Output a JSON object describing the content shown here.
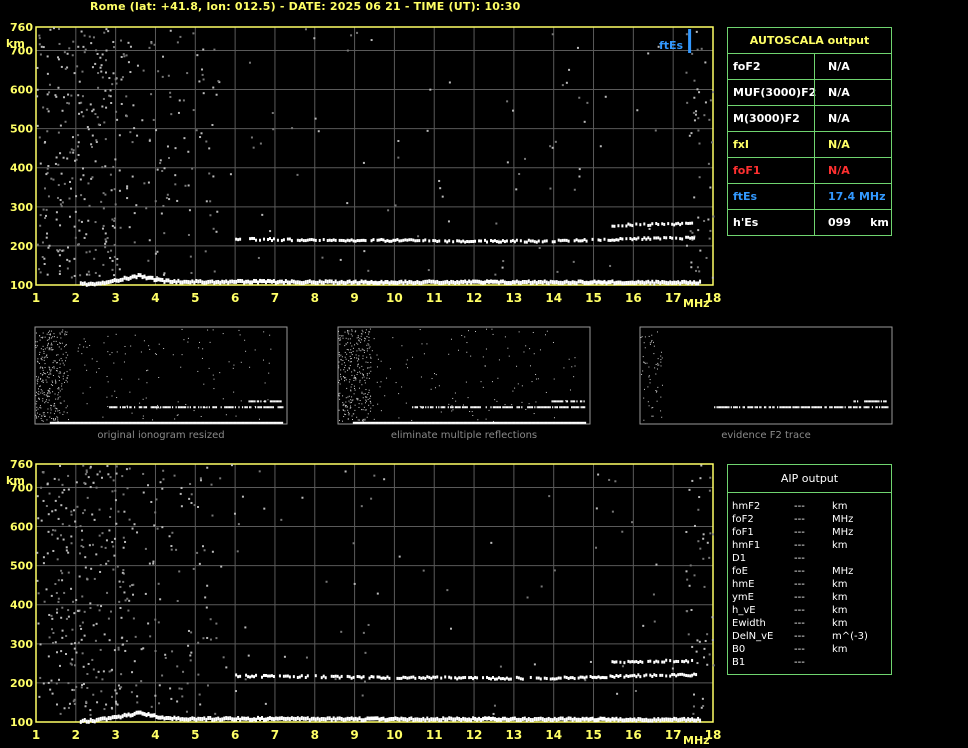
{
  "title": "Rome (lat: +41.8, lon: 012.5) - DATE: 2025 06 21 - TIME (UT): 10:30",
  "colors": {
    "frame": "#ffff66",
    "grid": "#5a5a5a",
    "table_border": "#6fd46f",
    "label_yellow": "#ffff66",
    "label_red": "#ff3030",
    "label_blue": "#3399ff",
    "caption": "#8a8a8a",
    "trace": "#ffffff"
  },
  "autoscala": {
    "title": "AUTOSCALA output",
    "rows": [
      {
        "name": "foF2",
        "value": "N/A",
        "color": "#ffffff"
      },
      {
        "name": "MUF(3000)F2",
        "value": "N/A",
        "color": "#ffffff"
      },
      {
        "name": "M(3000)F2",
        "value": "N/A",
        "color": "#ffffff"
      },
      {
        "name": "fxI",
        "value": "N/A",
        "color": "#ffff66"
      },
      {
        "name": "foF1",
        "value": "N/A",
        "color": "#ff3030"
      },
      {
        "name": "ftEs",
        "value": "17.4 MHz",
        "color": "#3399ff"
      },
      {
        "name": "h'Es",
        "value": "099     km",
        "color": "#ffffff"
      }
    ]
  },
  "aip": {
    "title": "AIP output",
    "rows": [
      {
        "name": "hmF2",
        "value": "---",
        "unit": "km"
      },
      {
        "name": "foF2",
        "value": "---",
        "unit": "MHz"
      },
      {
        "name": "foF1",
        "value": "---",
        "unit": "MHz"
      },
      {
        "name": "hmF1",
        "value": "---",
        "unit": "km"
      },
      {
        "name": "D1",
        "value": "---",
        "unit": ""
      },
      {
        "name": "foE",
        "value": "---",
        "unit": "MHz"
      },
      {
        "name": "hmE",
        "value": "---",
        "unit": "km"
      },
      {
        "name": "ymE",
        "value": "---",
        "unit": "km"
      },
      {
        "name": "h_vE",
        "value": "---",
        "unit": "km"
      },
      {
        "name": "Ewidth",
        "value": "---",
        "unit": "km"
      },
      {
        "name": "DelN_vE",
        "value": "---",
        "unit": "m^(-3)"
      },
      {
        "name": "B0",
        "value": "---",
        "unit": "km"
      },
      {
        "name": "B1",
        "value": "---",
        "unit": ""
      }
    ]
  },
  "captions": [
    "original ionogram resized",
    "eliminate multiple reflections",
    "evidence F2 trace"
  ],
  "chart_data": [
    {
      "type": "scatter",
      "name_id": "top-ionogram",
      "xlabel": "MHz",
      "ylabel": "km",
      "xlim": [
        1,
        18
      ],
      "ylim": [
        100,
        760
      ],
      "xticks": [
        1,
        2,
        3,
        4,
        5,
        6,
        7,
        8,
        9,
        10,
        11,
        12,
        13,
        14,
        15,
        16,
        17,
        18
      ],
      "yticks": [
        100,
        200,
        300,
        400,
        500,
        600,
        700,
        760
      ],
      "grid": true,
      "annotation": {
        "text": "ftEs",
        "x": 17.4
      },
      "traces": {
        "e_trace": [
          [
            2.1,
            102
          ],
          [
            2.5,
            104
          ],
          [
            3.0,
            112
          ],
          [
            3.3,
            118
          ],
          [
            3.6,
            124
          ],
          [
            3.8,
            118
          ],
          [
            4.2,
            110
          ],
          [
            5,
            108
          ],
          [
            6,
            108
          ],
          [
            7,
            108
          ],
          [
            8,
            107
          ],
          [
            9,
            107
          ],
          [
            10,
            107
          ],
          [
            11,
            107
          ],
          [
            12,
            107
          ],
          [
            13,
            107
          ],
          [
            14,
            107
          ],
          [
            15,
            107
          ],
          [
            16,
            106
          ],
          [
            17,
            106
          ],
          [
            17.7,
            106
          ]
        ],
        "es_trace": [
          [
            6.0,
            218
          ],
          [
            7,
            216
          ],
          [
            8,
            216
          ],
          [
            9,
            214
          ],
          [
            10,
            214
          ],
          [
            11,
            213
          ],
          [
            12,
            212
          ],
          [
            13,
            212
          ],
          [
            14,
            212
          ],
          [
            15,
            215
          ],
          [
            16,
            218
          ],
          [
            17,
            220
          ],
          [
            17.6,
            220
          ]
        ],
        "es_upper": [
          [
            15.4,
            252
          ],
          [
            16,
            254
          ],
          [
            17,
            256
          ],
          [
            17.5,
            256
          ]
        ]
      }
    },
    {
      "type": "scatter",
      "name_id": "bottom-ionogram",
      "xlabel": "MHz",
      "ylabel": "km",
      "xlim": [
        1,
        18
      ],
      "ylim": [
        100,
        760
      ],
      "xticks": [
        1,
        2,
        3,
        4,
        5,
        6,
        7,
        8,
        9,
        10,
        11,
        12,
        13,
        14,
        15,
        16,
        17,
        18
      ],
      "yticks": [
        100,
        200,
        300,
        400,
        500,
        600,
        700,
        760
      ],
      "grid": true
    }
  ]
}
